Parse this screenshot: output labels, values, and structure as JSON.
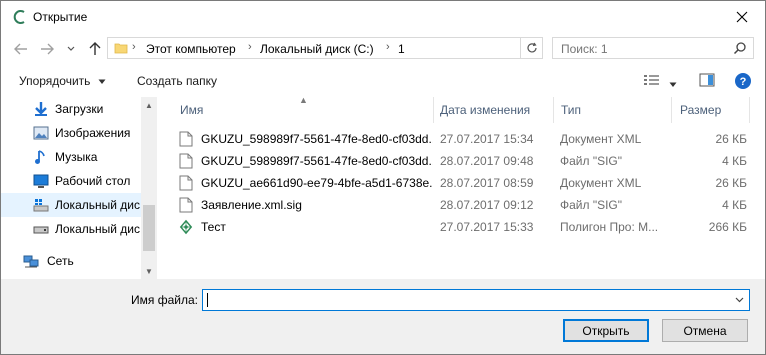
{
  "window": {
    "title": "Открытие"
  },
  "address": {
    "crumbs": [
      "Этот компьютер",
      "Локальный диск (C:)",
      "1"
    ]
  },
  "search": {
    "placeholder": "Поиск: 1"
  },
  "toolbar": {
    "organize_label": "Упорядочить",
    "new_folder_label": "Создать папку",
    "help_label": "?"
  },
  "nav": {
    "items": [
      {
        "label": "Загрузки",
        "icon": "downloads-icon"
      },
      {
        "label": "Изображения",
        "icon": "pictures-icon"
      },
      {
        "label": "Музыка",
        "icon": "music-icon"
      },
      {
        "label": "Рабочий стол",
        "icon": "desktop-icon"
      },
      {
        "label": "Локальный дис",
        "icon": "drive-c-icon"
      },
      {
        "label": "Локальный дис",
        "icon": "drive-icon"
      },
      {
        "label": "Сеть",
        "icon": "network-icon"
      }
    ]
  },
  "columns": {
    "name": "Имя",
    "date": "Дата изменения",
    "type": "Тип",
    "size": "Размер"
  },
  "files": [
    {
      "name": "GKUZU_598989f7-5561-47fe-8ed0-cf03dd...",
      "date": "27.07.2017 15:34",
      "type": "Документ XML",
      "size": "26 КБ",
      "icon": "document-icon"
    },
    {
      "name": "GKUZU_598989f7-5561-47fe-8ed0-cf03dd...",
      "date": "28.07.2017 09:48",
      "type": "Файл \"SIG\"",
      "size": "4 КБ",
      "icon": "document-icon"
    },
    {
      "name": "GKUZU_ae661d90-ee79-4bfe-a5d1-6738e...",
      "date": "28.07.2017 08:59",
      "type": "Документ XML",
      "size": "26 КБ",
      "icon": "document-icon"
    },
    {
      "name": "Заявление.xml.sig",
      "date": "28.07.2017 09:12",
      "type": "Файл \"SIG\"",
      "size": "4 КБ",
      "icon": "document-icon"
    },
    {
      "name": "Тест",
      "date": "27.07.2017 15:33",
      "type": "Полигон Про: М...",
      "size": "266 КБ",
      "icon": "polygon-icon"
    }
  ],
  "footer": {
    "filename_label": "Имя файла:",
    "filename_value": "",
    "open_label": "Открыть",
    "cancel_label": "Отмена"
  },
  "colors": {
    "accent": "#0078d7",
    "selected_bg": "#cce8ff",
    "header_text": "#4c607a"
  }
}
